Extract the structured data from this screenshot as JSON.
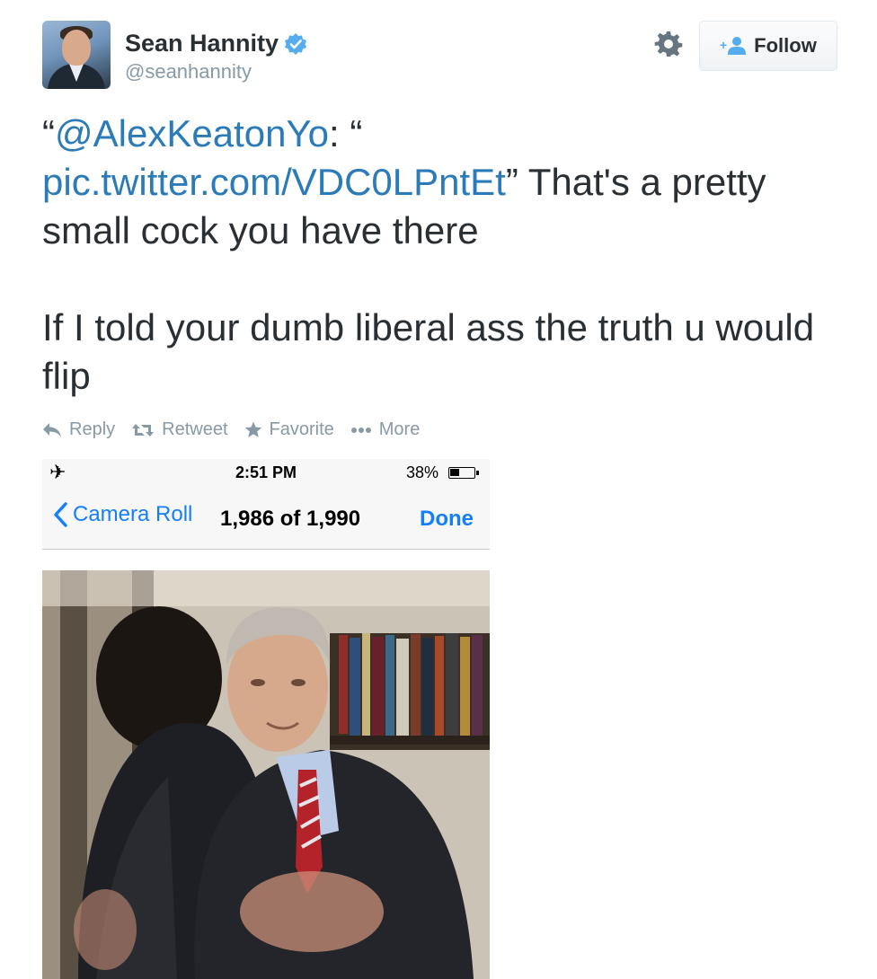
{
  "user": {
    "name": "Sean Hannity",
    "handle": "@seanhannity",
    "verified": true
  },
  "header": {
    "follow_label": "Follow"
  },
  "tweet": {
    "quote_open": "“",
    "mention": "@AlexKeatonYo",
    "after_mention": ": “",
    "link": "pic.twitter.com/VDC0LPntEt",
    "after_link": "” That's a pretty small cock you have there",
    "paragraph2": "If I told your dumb liberal ass the truth u would flip"
  },
  "actions": [
    {
      "label": "Reply",
      "icon": "reply-icon"
    },
    {
      "label": "Retweet",
      "icon": "retweet-icon"
    },
    {
      "label": "Favorite",
      "icon": "star-icon"
    },
    {
      "label": "More",
      "icon": "more-dots-icon"
    }
  ],
  "embedded_screenshot": {
    "status_bar": {
      "time": "2:51 PM",
      "battery_percent_label": "38%",
      "battery_level": 0.38,
      "airplane_icon": "✈"
    },
    "nav": {
      "back_label": "Camera Roll",
      "title": "1,986 of 1,990",
      "done_label": "Done"
    }
  },
  "colors": {
    "link": "#2b7bb9",
    "text": "#292f33",
    "muted": "#8899a6",
    "verified": "#55acee",
    "ios_blue": "#157efb"
  }
}
